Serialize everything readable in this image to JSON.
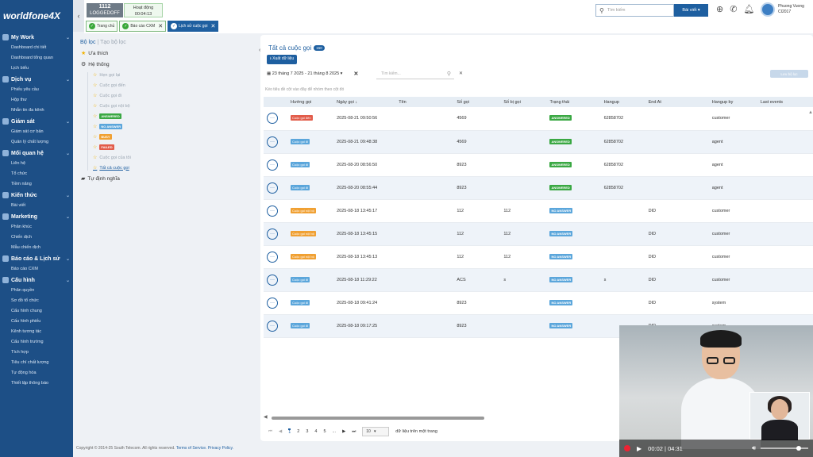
{
  "app": {
    "logo": "worldfone4X",
    "collapse_icon": "‹"
  },
  "sidebar": [
    {
      "label": "My Work",
      "items": [
        "Dashboard chi tiết",
        "Dashboard tổng quan",
        "Lịch biểu"
      ]
    },
    {
      "label": "Dịch vụ",
      "items": [
        "Phiếu yêu cầu",
        "Hộp thư",
        "Nhắn tin đa kênh"
      ]
    },
    {
      "label": "Giám sát",
      "items": [
        "Giám sát cơ bản",
        "Quản lý chất lượng"
      ]
    },
    {
      "label": "Mối quan hệ",
      "items": [
        "Liên hệ",
        "Tổ chức",
        "Tiềm năng"
      ]
    },
    {
      "label": "Kiến thức",
      "items": [
        "Bài viết"
      ]
    },
    {
      "label": "Marketing",
      "items": [
        "Phân khúc",
        "Chiến dịch",
        "Mẫu chiến dịch"
      ]
    },
    {
      "label": "Báo cáo & Lịch sử",
      "items": [
        "Báo cáo CXM"
      ]
    },
    {
      "label": "Cấu hình",
      "items": [
        "Phân quyền",
        "Sơ đồ tổ chức",
        "Cấu hình chung",
        "Cấu hình phiếu",
        "Kênh tương tác",
        "Cấu hình trường",
        "Tích hợp",
        "Tiêu chí chất lượng",
        "Tự động hóa",
        "Thiết lập thông báo"
      ]
    }
  ],
  "topbar": {
    "extension": "1112",
    "extension_status": "LOGGEDOFF",
    "activity_label": "Hoạt động",
    "activity_timer": "00:04:13",
    "tabs": [
      {
        "label": "Trang chủ",
        "closable": false,
        "active": false
      },
      {
        "label": "Báo cáo CXM",
        "closable": true,
        "active": false
      },
      {
        "label": "Lịch sử cuộc gọi",
        "closable": true,
        "active": true
      }
    ],
    "search_placeholder": "Tìm kiếm",
    "search_scope": "Bài viết",
    "user_name": "Phuong Vuong",
    "user_id": "CI2017"
  },
  "filter": {
    "tab_active": "Bộ lọc",
    "tab_other": "Tạo bộ lọc",
    "favorites": "Ưa thích",
    "system": "Hệ thống",
    "custom": "Tự định nghĩa",
    "items": [
      {
        "label": "Hẹn gọi lại",
        "badge": null,
        "color": null
      },
      {
        "label": "Cuộc gọi đến",
        "badge": null,
        "color": null
      },
      {
        "label": "Cuộc gọi đi",
        "badge": null,
        "color": null
      },
      {
        "label": "Cuộc gọi nội bộ",
        "badge": null,
        "color": null
      },
      {
        "label": "",
        "badge": "ANSWERED",
        "color": "#3aa843"
      },
      {
        "label": "",
        "badge": "NO ANSWER",
        "color": "#5ba6db"
      },
      {
        "label": "",
        "badge": "BUSY",
        "color": "#f0a032"
      },
      {
        "label": "",
        "badge": "FAILED",
        "color": "#e25c4a"
      },
      {
        "label": "Cuộc gọi của tôi",
        "badge": null,
        "color": null
      },
      {
        "label": "Tất cả cuộc gọi",
        "badge": null,
        "color": null,
        "current": true
      }
    ]
  },
  "panel": {
    "title": "Tất cả cuộc gọi",
    "count": "150",
    "export_label": "Xuất dữ liệu",
    "date_range": "23 tháng 7 2025 - 21 tháng 8 2025",
    "search_placeholder": "Tìm kiếm...",
    "save_filter": "Lưu bộ lọc",
    "hint": "Kéo tiêu đề cột vào đây để nhóm theo cột đó",
    "columns": [
      "",
      "Hướng gọi",
      "Ngày gọi ↓",
      "Tên",
      "Số gọi",
      "Số bị gọi",
      "Trạng thái",
      "Hangup",
      "End At",
      "Hangup by",
      "Last events"
    ],
    "rows": [
      {
        "dir": "Cuộc gọi đến",
        "dir_color": "#e25c4a",
        "date": "2025-08-21 09:50:56",
        "name": "",
        "caller": "4569",
        "callee": "",
        "status": "ANSWERED",
        "status_color": "#3aa843",
        "hangup": "62858702",
        "end_at": "",
        "hangup_by": "customer",
        "last": ""
      },
      {
        "dir": "Cuộc gọi đi",
        "dir_color": "#5ba6db",
        "date": "2025-08-21 09:48:38",
        "name": "",
        "caller": "4569",
        "callee": "",
        "status": "ANSWERED",
        "status_color": "#3aa843",
        "hangup": "62858702",
        "end_at": "",
        "hangup_by": "agent",
        "last": ""
      },
      {
        "dir": "Cuộc gọi đi",
        "dir_color": "#5ba6db",
        "date": "2025-08-20 08:56:50",
        "name": "",
        "caller": "8923",
        "callee": "",
        "status": "ANSWERED",
        "status_color": "#3aa843",
        "hangup": "62858702",
        "end_at": "",
        "hangup_by": "agent",
        "last": ""
      },
      {
        "dir": "Cuộc gọi đi",
        "dir_color": "#5ba6db",
        "date": "2025-08-20 08:55:44",
        "name": "",
        "caller": "8923",
        "callee": "",
        "status": "ANSWERED",
        "status_color": "#3aa843",
        "hangup": "62858702",
        "end_at": "",
        "hangup_by": "agent",
        "last": ""
      },
      {
        "dir": "Cuộc gọi nội bộ",
        "dir_color": "#f0a032",
        "date": "2025-08-18 13:45:17",
        "name": "",
        "caller": "112",
        "callee": "112",
        "status": "NO ANSWER",
        "status_color": "#5ba6db",
        "hangup": "",
        "end_at": "DID",
        "hangup_by": "customer",
        "last": ""
      },
      {
        "dir": "Cuộc gọi nội bộ",
        "dir_color": "#f0a032",
        "date": "2025-08-18 13:45:15",
        "name": "",
        "caller": "112",
        "callee": "112",
        "status": "NO ANSWER",
        "status_color": "#5ba6db",
        "hangup": "",
        "end_at": "DID",
        "hangup_by": "customer",
        "last": ""
      },
      {
        "dir": "Cuộc gọi nội bộ",
        "dir_color": "#f0a032",
        "date": "2025-08-18 13:45:13",
        "name": "",
        "caller": "112",
        "callee": "112",
        "status": "NO ANSWER",
        "status_color": "#5ba6db",
        "hangup": "",
        "end_at": "DID",
        "hangup_by": "customer",
        "last": ""
      },
      {
        "dir": "Cuộc gọi đi",
        "dir_color": "#5ba6db",
        "date": "2025-08-18 11:29:22",
        "name": "",
        "caller": "ACS",
        "callee": "s",
        "status": "NO ANSWER",
        "status_color": "#5ba6db",
        "hangup": "s",
        "end_at": "DID",
        "hangup_by": "customer",
        "last": ""
      },
      {
        "dir": "Cuộc gọi đi",
        "dir_color": "#5ba6db",
        "date": "2025-08-18 09:41:24",
        "name": "",
        "caller": "8923",
        "callee": "",
        "status": "NO ANSWER",
        "status_color": "#5ba6db",
        "hangup": "",
        "end_at": "DID",
        "hangup_by": "system",
        "last": ""
      },
      {
        "dir": "Cuộc gọi đi",
        "dir_color": "#5ba6db",
        "date": "2025-08-18 09:17:25",
        "name": "",
        "caller": "8923",
        "callee": "",
        "status": "NO ANSWER",
        "status_color": "#5ba6db",
        "hangup": "",
        "end_at": "DID",
        "hangup_by": "system",
        "last": ""
      }
    ],
    "pager": {
      "pages": [
        "1",
        "2",
        "3",
        "4",
        "5",
        "..."
      ],
      "current": "1",
      "page_size": "10",
      "info": "dữ liệu trên một trang"
    }
  },
  "footer": {
    "copyright": "Copyright © 2014-25 South Telecom. All rights reserved.",
    "terms": "Terms of Service.",
    "privacy": "Privacy Policy."
  },
  "video": {
    "time_current": "00:02",
    "time_total": "04:31",
    "separator": "|",
    "volume": 0.75
  }
}
